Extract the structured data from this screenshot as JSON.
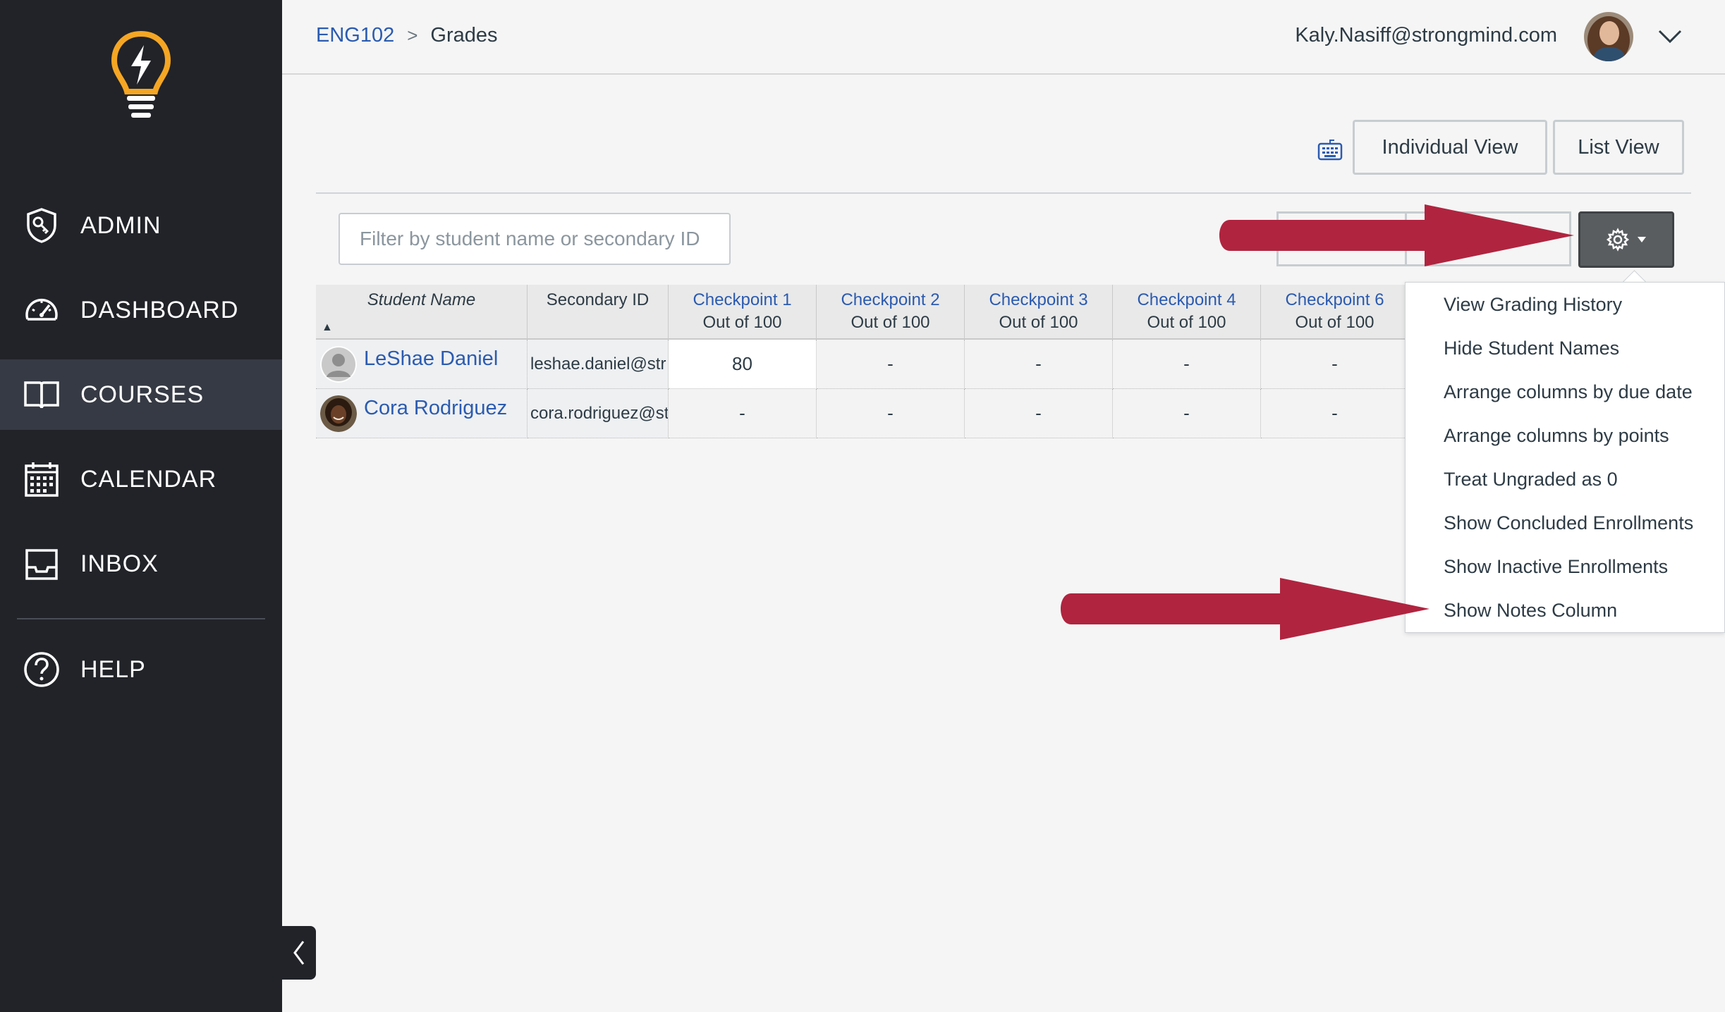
{
  "sidebar": {
    "items": [
      {
        "label": "ADMIN",
        "icon": "admin-shield-icon"
      },
      {
        "label": "DASHBOARD",
        "icon": "speedometer-icon"
      },
      {
        "label": "COURSES",
        "icon": "book-icon",
        "active": true
      },
      {
        "label": "CALENDAR",
        "icon": "calendar-icon"
      },
      {
        "label": "INBOX",
        "icon": "inbox-tray-icon"
      },
      {
        "label": "HELP",
        "icon": "help-circle-icon"
      }
    ],
    "logo_icon": "lightbulb-logo-icon",
    "collapse_icon": "chevron-left-icon"
  },
  "header": {
    "breadcrumb": {
      "course": "ENG102",
      "separator": ">",
      "current": "Grades"
    },
    "user_email": "Kaly.Nasiff@strongmind.com"
  },
  "toolbar": {
    "individual_view": "Individual View",
    "list_view": "List View",
    "filter_placeholder": "Filter by student name or secondary ID"
  },
  "grid": {
    "columns": [
      {
        "title": "Student Name",
        "sub": ""
      },
      {
        "title": "Secondary ID",
        "sub": ""
      },
      {
        "title": "Checkpoint 1",
        "sub": "Out of 100"
      },
      {
        "title": "Checkpoint 2",
        "sub": "Out of 100"
      },
      {
        "title": "Checkpoint 3",
        "sub": "Out of 100"
      },
      {
        "title": "Checkpoint 4",
        "sub": "Out of 100"
      },
      {
        "title": "Checkpoint 6",
        "sub": "Out of 100"
      }
    ],
    "sort_indicator": "▲",
    "rows": [
      {
        "name": "LeShae Daniel",
        "secondary_id": "leshae.daniel@str",
        "scores": [
          "80",
          "-",
          "-",
          "-",
          "-"
        ]
      },
      {
        "name": "Cora Rodriguez",
        "secondary_id": "cora.rodriguez@st",
        "scores": [
          "-",
          "-",
          "-",
          "-",
          "-"
        ]
      }
    ]
  },
  "settings_menu": {
    "items": [
      "View Grading History",
      "Hide Student Names",
      "Arrange columns by due date",
      "Arrange columns by points",
      "Treat Ungraded as 0",
      "Show Concluded Enrollments",
      "Show Inactive Enrollments",
      "Show Notes Column"
    ]
  },
  "colors": {
    "sidebar_bg": "#212329",
    "active_nav_bg": "#363a44",
    "link": "#2b5bb0",
    "accent_logo": "#f5a623",
    "annotation_arrow": "#b0243f",
    "gear_button_bg": "#5a5d60"
  }
}
